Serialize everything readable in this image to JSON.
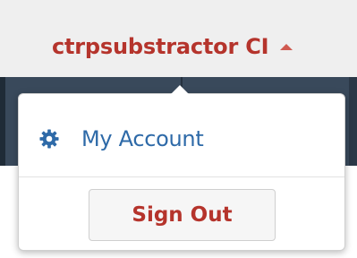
{
  "header": {
    "user_name": "ctrpsubstractor CI",
    "caret_icon": "caret-up-icon",
    "name_color": "#b5342c"
  },
  "dropdown": {
    "items": [
      {
        "label": "My Account",
        "icon": "gear-icon",
        "color": "#2e6aa8"
      }
    ],
    "sign_out_label": "Sign Out"
  }
}
